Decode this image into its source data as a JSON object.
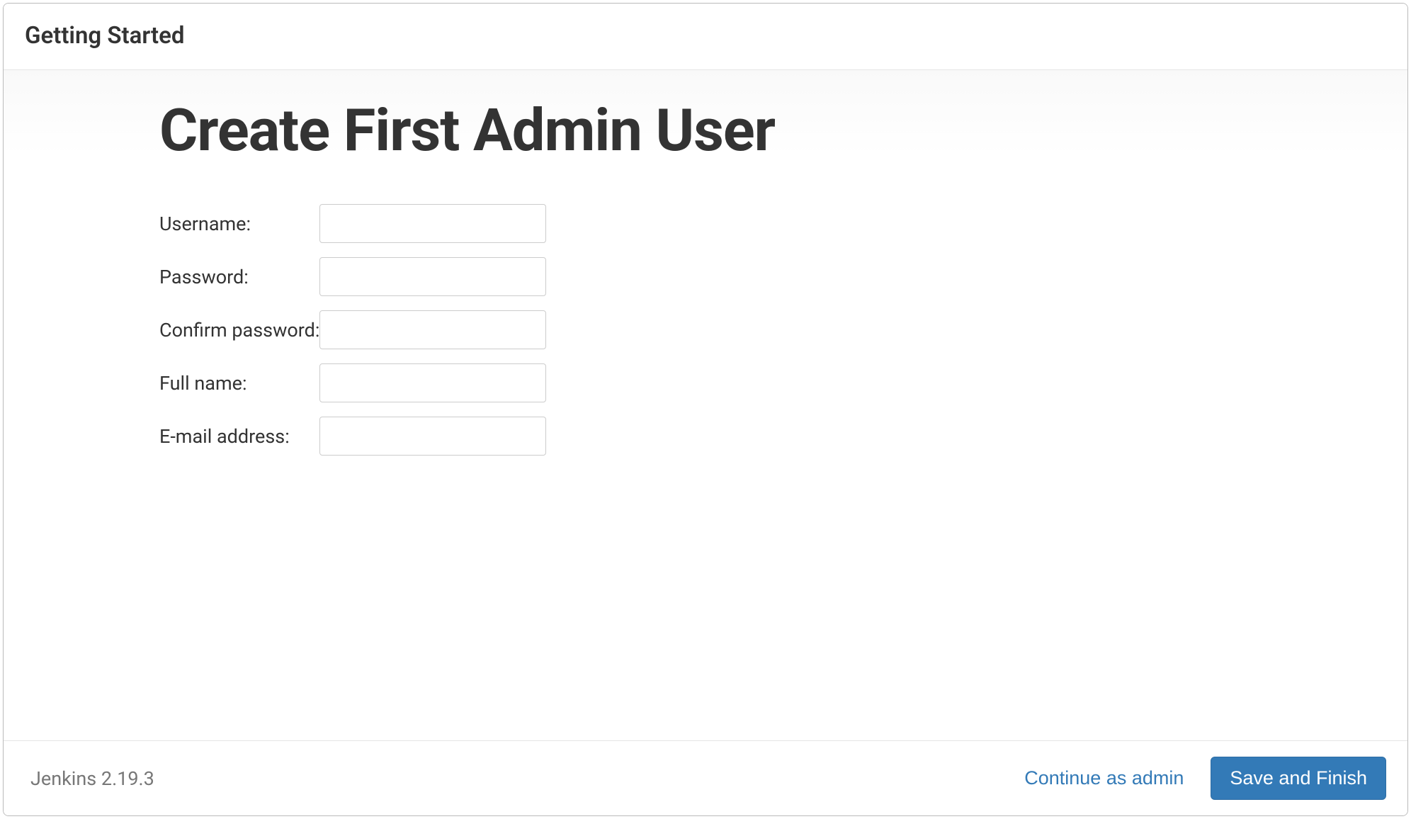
{
  "header": {
    "title": "Getting Started"
  },
  "main": {
    "heading": "Create First Admin User",
    "fields": {
      "username_label": "Username:",
      "username_value": "",
      "password_label": "Password:",
      "password_value": "",
      "confirm_password_label": "Confirm password:",
      "confirm_password_value": "",
      "fullname_label": "Full name:",
      "fullname_value": "",
      "email_label": "E-mail address:",
      "email_value": ""
    }
  },
  "footer": {
    "version": "Jenkins 2.19.3",
    "continue_label": "Continue as admin",
    "save_label": "Save and Finish"
  }
}
